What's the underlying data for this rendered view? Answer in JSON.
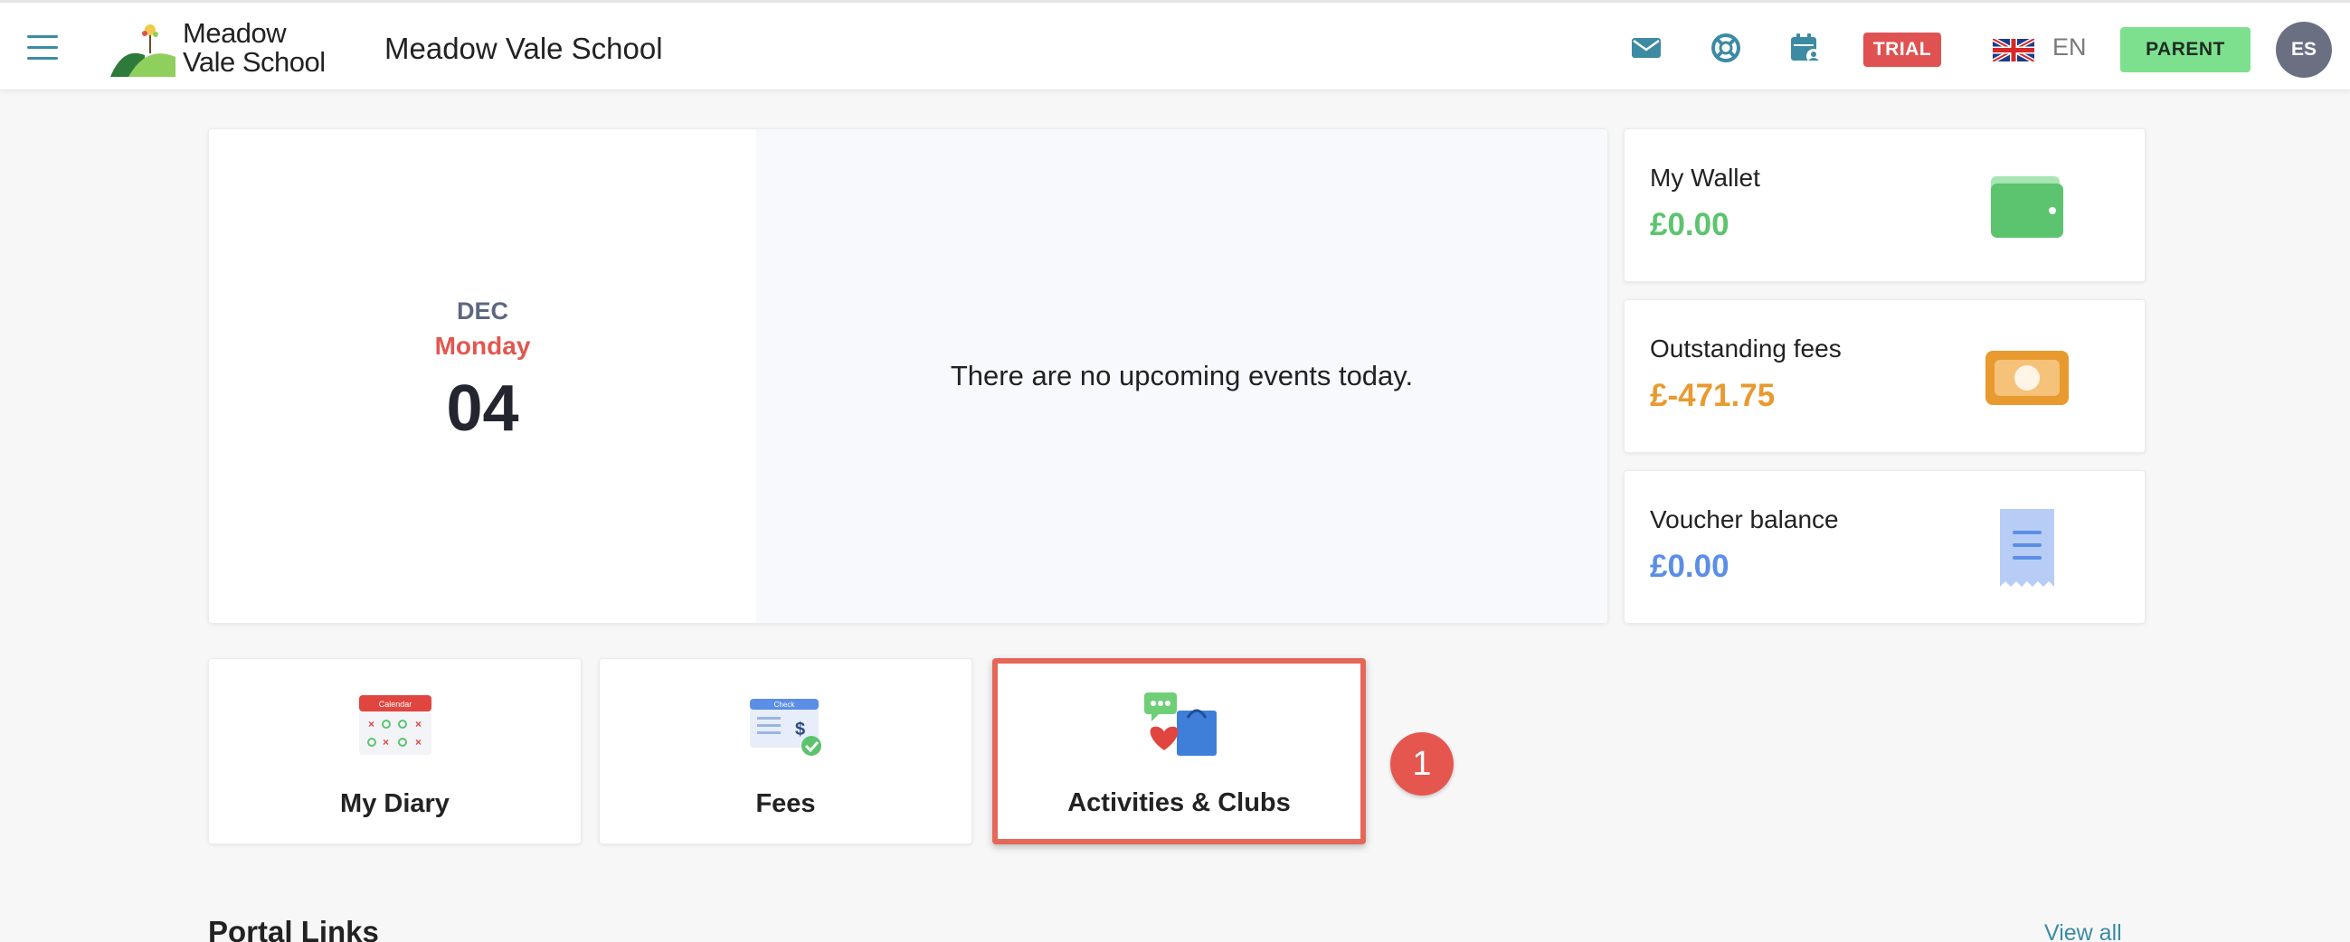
{
  "header": {
    "logo_line1": "Meadow",
    "logo_line2": "Vale School",
    "school_name": "Meadow Vale School",
    "trial_badge": "TRIAL",
    "language": "EN",
    "role_button": "PARENT",
    "avatar_initials": "ES",
    "icons": [
      "mail-icon",
      "support-lifebuoy-icon",
      "calendar-user-icon",
      "uk-flag-icon"
    ]
  },
  "calendar": {
    "month": "DEC",
    "weekday": "Monday",
    "day": "04",
    "no_events": "There are no upcoming events today."
  },
  "stats": [
    {
      "label": "My Wallet",
      "value": "£0.00",
      "color": "#5cc46e",
      "icon": "wallet-icon"
    },
    {
      "label": "Outstanding fees",
      "value": "£-471.75",
      "color": "#e89a2f",
      "icon": "banknote-icon"
    },
    {
      "label": "Voucher balance",
      "value": "£0.00",
      "color": "#5b8ee6",
      "icon": "receipt-icon"
    }
  ],
  "tiles": [
    {
      "label": "My Diary",
      "icon": "calendar-diary-icon",
      "icon_text": "Calendar"
    },
    {
      "label": "Fees",
      "icon": "fees-check-icon",
      "icon_text": "Check"
    },
    {
      "label": "Activities & Clubs",
      "icon": "activities-bag-icon"
    }
  ],
  "step_marker": "1",
  "portal_links": {
    "title": "Portal Links",
    "view_all": "View all"
  },
  "colors": {
    "accent_teal": "#3c8ba3",
    "trial_red": "#e05252",
    "parent_green": "#7de08f",
    "highlight_red": "#e5675a"
  }
}
